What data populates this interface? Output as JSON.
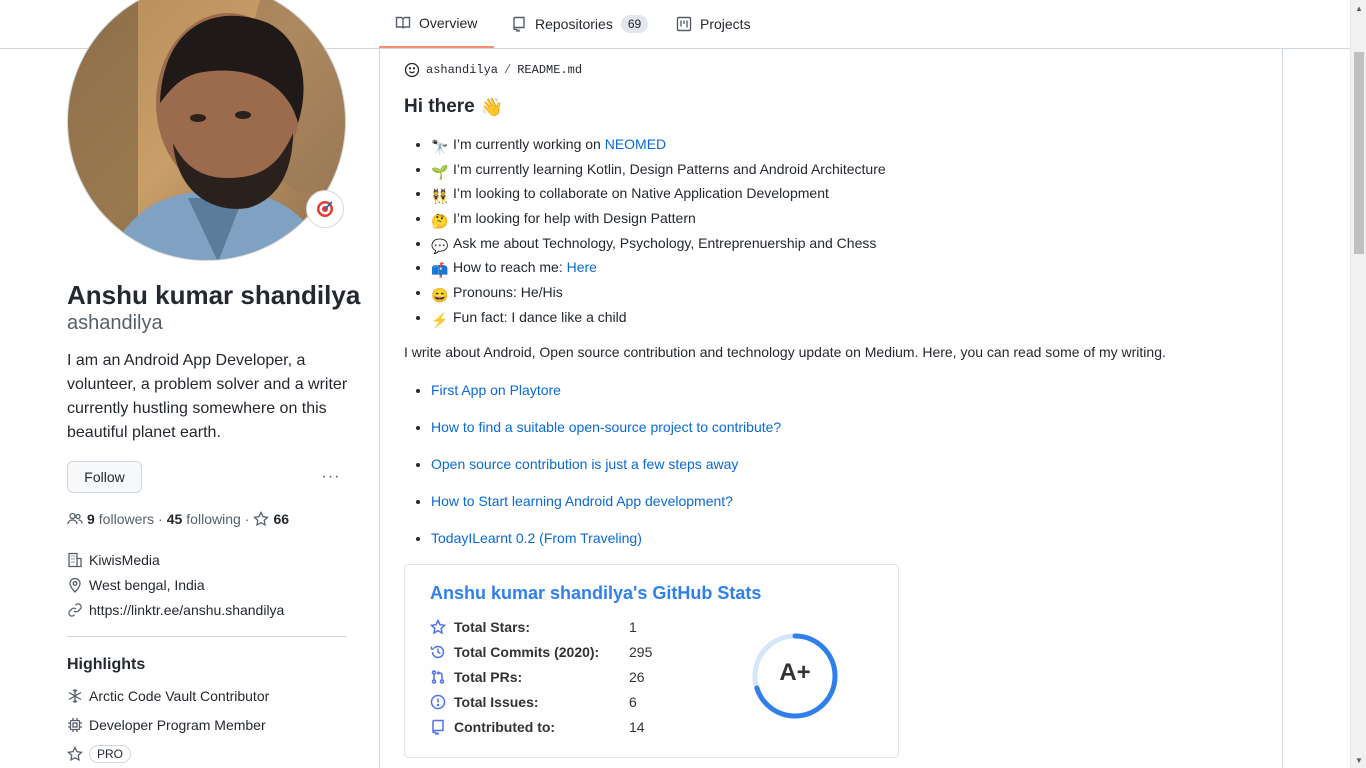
{
  "tabs": [
    {
      "label": "Overview",
      "icon": "book-icon",
      "active": true
    },
    {
      "label": "Repositories",
      "icon": "repo-icon",
      "count": "69"
    },
    {
      "label": "Projects",
      "icon": "project-icon"
    }
  ],
  "profile": {
    "name": "Anshu kumar shandilya",
    "login": "ashandilya",
    "bio": "I am an Android App Developer, a volunteer, a problem solver and a writer currently hustling somewhere on this beautiful planet earth.",
    "follow_label": "Follow",
    "more_label": "···",
    "followers_count": "9",
    "followers_label": "followers",
    "following_count": "45",
    "following_label": "following",
    "stars_count": "66",
    "company": "KiwisMedia",
    "location": "West bengal, India",
    "website": "https://linktr.ee/anshu.shandilya",
    "highlights_title": "Highlights",
    "highlights": [
      {
        "label": "Arctic Code Vault Contributor",
        "icon": "snowflake-icon"
      },
      {
        "label": "Developer Program Member",
        "icon": "cpu-icon"
      },
      {
        "label": "PRO",
        "icon": "star-icon"
      }
    ]
  },
  "readme": {
    "owner": "ashandilya",
    "separator": "/",
    "file": "README.md",
    "heading": "Hi there",
    "heading_emoji": "👋",
    "bullets": [
      {
        "emoji": "🔭",
        "text": "I’m currently working on ",
        "link": "NEOMED"
      },
      {
        "emoji": "🌱",
        "text": "I’m currently learning Kotlin, Design Patterns and Android Architecture"
      },
      {
        "emoji": "👯",
        "text": "I’m looking to collaborate on Native Application Development"
      },
      {
        "emoji": "🤔",
        "text": "I’m looking for help with Design Pattern"
      },
      {
        "emoji": "💬",
        "text": "Ask me about Technology, Psychology, Entreprenuership and Chess"
      },
      {
        "emoji": "📫",
        "text": "How to reach me: ",
        "link": "Here"
      },
      {
        "emoji": "😄",
        "text": "Pronouns: He/His"
      },
      {
        "emoji": "⚡",
        "text": "Fun fact: I dance like a child"
      }
    ],
    "paragraph": "I write about Android, Open source contribution and technology update on Medium. Here, you can read some of my writing.",
    "articles": [
      "First App on Playtore",
      "How to find a suitable open-source project to contribute?",
      "Open source contribution is just a few steps away",
      "How to Start learning Android App development?",
      "TodayILearnt 0.2 (From Traveling)"
    ]
  },
  "stats": {
    "title": "Anshu kumar shandilya's GitHub Stats",
    "rows": [
      {
        "label": "Total Stars:",
        "value": "1",
        "icon": "star-icon"
      },
      {
        "label": "Total Commits (2020):",
        "value": "295",
        "icon": "history-icon"
      },
      {
        "label": "Total PRs:",
        "value": "26",
        "icon": "pull-request-icon"
      },
      {
        "label": "Total Issues:",
        "value": "6",
        "icon": "issue-icon"
      },
      {
        "label": "Contributed to:",
        "value": "14",
        "icon": "repo-icon"
      }
    ],
    "rank": "A+",
    "rank_progress": 0.7,
    "colors": {
      "title": "#2f80ed",
      "icon": "#4c71f2",
      "ring": "#2f80ed"
    }
  }
}
